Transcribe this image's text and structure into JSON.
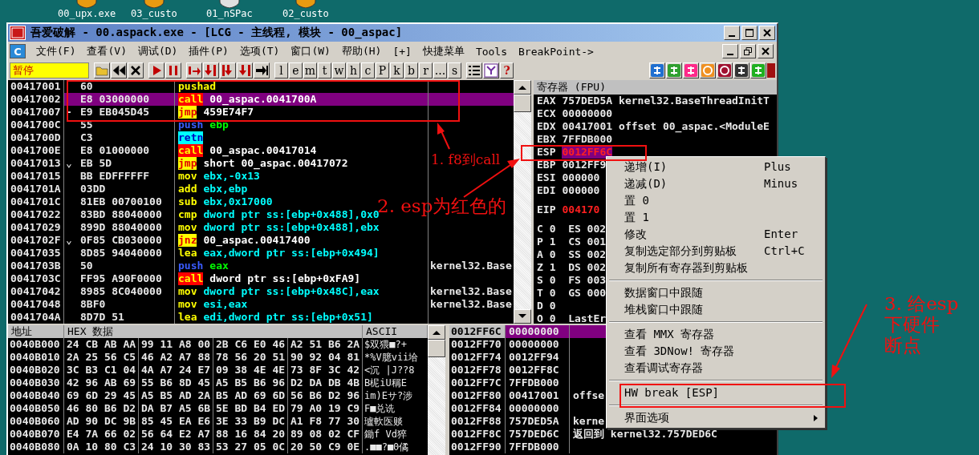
{
  "desktop_icons": [
    {
      "label": "00_upx.exe"
    },
    {
      "label": "03_custo"
    },
    {
      "label": "01_nSPac"
    },
    {
      "label": "02_custo"
    }
  ],
  "window": {
    "title": "吾爱破解 - 00.aspack.exe - [LCG - 主线程, 模块 - 00_aspac]"
  },
  "menu_bar": {
    "icon_label": "C",
    "items": [
      "文件(F)",
      "查看(V)",
      "调试(D)",
      "插件(P)",
      "选项(T)",
      "窗口(W)",
      "帮助(H)",
      "[+]",
      "快捷菜单",
      "Tools",
      "BreakPoint->"
    ]
  },
  "toolbar": {
    "status": "暂停",
    "letter_buttons": [
      "l",
      "e",
      "m",
      "t",
      "w",
      "h",
      "c",
      "P",
      "k",
      "b",
      "r",
      "...",
      "s"
    ],
    "help_label": "?"
  },
  "disassembly": [
    {
      "address": "00417001",
      "hex": "60",
      "mnemonic": "pushad",
      "kind": "plain",
      "selected": false
    },
    {
      "address": "00417002",
      "hex": "E8 03000000",
      "mnemonic": "call",
      "operands": "00_aspac.0041700A",
      "kind": "call",
      "selected": true
    },
    {
      "address": "00417007",
      "marker": "-",
      "hex": "E9 EB045D45",
      "mnemonic": "jmp",
      "operands": "459E74F7",
      "kind": "jump",
      "selected": false
    },
    {
      "address": "0041700C",
      "hex": "55",
      "mnemonic": "push",
      "operands": "ebp",
      "kind": "push",
      "selected": false
    },
    {
      "address": "0041700D",
      "hex": "C3",
      "mnemonic": "retn",
      "kind": "ret",
      "selected": false
    },
    {
      "address": "0041700E",
      "hex": "E8 01000000",
      "mnemonic": "call",
      "operands": "00_aspac.00417014",
      "kind": "call",
      "selected": false
    },
    {
      "address": "00417013",
      "marker": "⌄",
      "hex": "EB 5D",
      "mnemonic": "jmp",
      "operands": "short 00_aspac.00417072",
      "kind": "jump",
      "selected": false
    },
    {
      "address": "00417015",
      "hex": "BB EDFFFFFF",
      "mnemonic": "mov",
      "operands": "ebx,-0x13",
      "kind": "plain",
      "selected": false
    },
    {
      "address": "0041701A",
      "hex": "03DD",
      "mnemonic": "add",
      "operands": "ebx,ebp",
      "kind": "plain",
      "selected": false
    },
    {
      "address": "0041701C",
      "hex": "81EB 00700100",
      "mnemonic": "sub",
      "operands": "ebx,0x17000",
      "kind": "plain",
      "selected": false
    },
    {
      "address": "00417022",
      "hex": "83BD 88040000",
      "mnemonic": "cmp",
      "operands": "dword ptr ss:[ebp+0x488],0x0",
      "kind": "plain",
      "selected": false
    },
    {
      "address": "00417029",
      "hex": "899D 88040000",
      "mnemonic": "mov",
      "operands": "dword ptr ss:[ebp+0x488],ebx",
      "kind": "plain",
      "selected": false
    },
    {
      "address": "0041702F",
      "marker": "⌄",
      "hex": "0F85 CB030000",
      "mnemonic": "jnz",
      "operands": "00_aspac.00417400",
      "kind": "jump",
      "selected": false
    },
    {
      "address": "00417035",
      "hex": "8D85 94040000",
      "mnemonic": "lea",
      "operands": "eax,dword ptr ss:[ebp+0x494]",
      "kind": "plain",
      "selected": false
    },
    {
      "address": "0041703B",
      "hex": "50",
      "mnemonic": "push",
      "operands": "eax",
      "comment": "kernel32.Base",
      "kind": "push",
      "selected": false
    },
    {
      "address": "0041703C",
      "hex": "FF95 A90F0000",
      "mnemonic": "call",
      "operands": "dword ptr ss:[ebp+0xFA9]",
      "kind": "call",
      "selected": false
    },
    {
      "address": "00417042",
      "hex": "8985 8C040000",
      "mnemonic": "mov",
      "operands": "dword ptr ss:[ebp+0x48C],eax",
      "comment": "kernel32.Base",
      "kind": "plain",
      "selected": false
    },
    {
      "address": "00417048",
      "hex": "8BF0",
      "mnemonic": "mov",
      "operands": "esi,eax",
      "comment": "kernel32.Base",
      "kind": "plain",
      "selected": false
    },
    {
      "address": "0041704A",
      "hex": "8D7D 51",
      "mnemonic": "lea",
      "operands": "edi,dword ptr ss:[ebp+0x51]",
      "kind": "plain",
      "selected": false
    }
  ],
  "registers": {
    "title": "寄存器 (FPU)",
    "general": [
      {
        "name": "EAX",
        "value": "757DED5A",
        "comment": "kernel32.BaseThreadInitT",
        "changed": false,
        "selected": false
      },
      {
        "name": "ECX",
        "value": "00000000",
        "changed": false,
        "selected": false
      },
      {
        "name": "EDX",
        "value": "00417001",
        "comment": "offset 00_aspac.<ModuleE",
        "changed": false,
        "selected": false
      },
      {
        "name": "EBX",
        "value": "7FFDB000",
        "changed": false,
        "selected": false
      },
      {
        "name": "ESP",
        "value": "0012FF6C",
        "changed": true,
        "selected": true
      },
      {
        "name": "EBP",
        "value": "0012FF9",
        "changed": false,
        "selected": false
      },
      {
        "name": "ESI",
        "value": "000000",
        "changed": false,
        "selected": false
      },
      {
        "name": "EDI",
        "value": "000000",
        "changed": false,
        "selected": false
      }
    ],
    "eip": {
      "name": "EIP",
      "value": "004170",
      "changed": true,
      "selected": false
    },
    "flags": [
      "C 0  ES 002",
      "P 1  CS 001",
      "A 0  SS 002",
      "Z 1  DS 002",
      "S 0  FS 003",
      "T 0  GS 000",
      "D 0",
      "O 0  LastEr"
    ]
  },
  "dump": {
    "columns": [
      "地址",
      "HEX 数据",
      "ASCII"
    ],
    "rows": [
      {
        "address": "0040B000",
        "hex": [
          "24 CB AB AA",
          "99 11 A8 00",
          "2B C6 E0 46",
          "A2 51 B6 2A"
        ],
        "ascii": "$双猥■?+"
      },
      {
        "address": "0040B010",
        "hex": [
          "2A 25 56 C5",
          "46 A2 A7 88",
          "78 56 20 51",
          "90 92 04 81"
        ],
        "ascii": "*%V臆vii垥"
      },
      {
        "address": "0040B020",
        "hex": [
          "3C B3 C1 04",
          "4A A7 24 E7",
          "09 38 4E 4E",
          "73 8F 3C 42"
        ],
        "ascii": "<沉 |J??8"
      },
      {
        "address": "0040B030",
        "hex": [
          "42 96 AB 69",
          "55 B6 8D 45",
          "A5 B5 B6 96",
          "D2 DA DB 4B"
        ],
        "ascii": "B柅iU稱E"
      },
      {
        "address": "0040B040",
        "hex": [
          "69 6D 29 45",
          "A5 B5 AD 2A",
          "B5 AD 69 6D",
          "56 B6 D2 96"
        ],
        "ascii": "im)Eサ?涉"
      },
      {
        "address": "0040B050",
        "hex": [
          "46 80 B6 D2",
          "DA B7 A5 6B",
          "5E BD B4 ED",
          "79 A0 19 C9"
        ],
        "ascii": "F■兑诜"
      },
      {
        "address": "0040B060",
        "hex": [
          "AD 90 DC 9B",
          "85 45 EA E6",
          "3E 33 B9 DC",
          "A1 F8 77 30"
        ],
        "ascii": "瓐軟医赕"
      },
      {
        "address": "0040B070",
        "hex": [
          "E4 7A 66 02",
          "56 64 E2 A7",
          "88 16 84 20",
          "89 08 02 CF"
        ],
        "ascii": "鋤f Vd猝"
      },
      {
        "address": "0040B080",
        "hex": [
          "0A 10 80 C3",
          "24 10 30 83",
          "53 27 05 0C",
          "20 50 C9 0E"
        ],
        "ascii": ".■■?■0僪"
      }
    ]
  },
  "stack": [
    {
      "address": "0012FF6C",
      "value": "00000000",
      "selected": true
    },
    {
      "address": "0012FF70",
      "value": "00000000",
      "selected": false
    },
    {
      "address": "0012FF74",
      "value": "0012FF94",
      "selected": false
    },
    {
      "address": "0012FF78",
      "value": "0012FF8C",
      "selected": false
    },
    {
      "address": "0012FF7C",
      "value": "7FFDB000",
      "selected": false
    },
    {
      "address": "0012FF80",
      "value": "00417001",
      "comment": "offse",
      "selected": false
    },
    {
      "address": "0012FF84",
      "value": "00000000",
      "selected": false
    },
    {
      "address": "0012FF88",
      "value": "757DED5A",
      "comment": "kerne",
      "selected": false
    },
    {
      "address": "0012FF8C",
      "value": "757DED6C",
      "comment": "返回到 kernel32.757DED6C",
      "selected": false
    },
    {
      "address": "0012FF90",
      "value": "7FFDB000",
      "selected": false
    }
  ],
  "context_menu": [
    {
      "kind": "item",
      "label": "递增(I)",
      "shortcut": "Plus"
    },
    {
      "kind": "item",
      "label": "递减(D)",
      "shortcut": "Minus"
    },
    {
      "kind": "item",
      "label": "置 0"
    },
    {
      "kind": "item",
      "label": "置 1"
    },
    {
      "kind": "item",
      "label": "修改",
      "shortcut": "Enter"
    },
    {
      "kind": "item",
      "label": "复制选定部分到剪贴板",
      "shortcut": "Ctrl+C"
    },
    {
      "kind": "item",
      "label": "复制所有寄存器到剪贴板"
    },
    {
      "kind": "separator"
    },
    {
      "kind": "item",
      "label": "数据窗口中跟随"
    },
    {
      "kind": "item",
      "label": "堆栈窗口中跟随"
    },
    {
      "kind": "separator"
    },
    {
      "kind": "item",
      "label": "查看 MMX 寄存器"
    },
    {
      "kind": "item",
      "label": "查看 3DNow! 寄存器"
    },
    {
      "kind": "item",
      "label": "查看调试寄存器"
    },
    {
      "kind": "separator"
    },
    {
      "kind": "item",
      "label": "HW break [ESP]"
    },
    {
      "kind": "separator"
    },
    {
      "kind": "submenu",
      "label": "界面选项"
    }
  ],
  "annotations": [
    {
      "lines": [
        "1. f8到call"
      ]
    },
    {
      "lines": [
        "2. esp为红色的"
      ]
    },
    {
      "lines": [
        "3. 给esp",
        "下硬件",
        "断点"
      ]
    }
  ]
}
